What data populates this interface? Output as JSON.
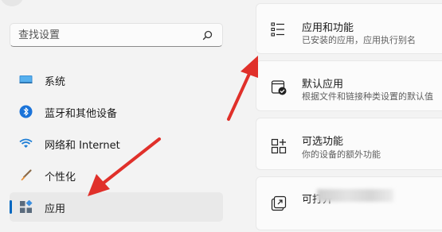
{
  "search": {
    "placeholder": "查找设置"
  },
  "sidebar": {
    "items": [
      {
        "label": "系统",
        "icon": "monitor-icon"
      },
      {
        "label": "蓝牙和其他设备",
        "icon": "bluetooth-icon"
      },
      {
        "label": "网络和 Internet",
        "icon": "wifi-icon"
      },
      {
        "label": "个性化",
        "icon": "brush-icon"
      },
      {
        "label": "应用",
        "icon": "apps-icon",
        "selected": true
      }
    ]
  },
  "cards": [
    {
      "title": "应用和功能",
      "description": "已安装的应用，应用执行别名",
      "icon": "list-icon"
    },
    {
      "title": "默认应用",
      "description": "根据文件和链接种类设置的默认值",
      "icon": "default-apps-icon"
    },
    {
      "title": "可选功能",
      "description": "你的设备的额外功能",
      "icon": "optional-features-icon"
    },
    {
      "title": "可打开",
      "description": "",
      "icon": "open-with-icon"
    }
  ],
  "colors": {
    "accent": "#0067c0",
    "annotation_arrow": "#e0302a"
  }
}
